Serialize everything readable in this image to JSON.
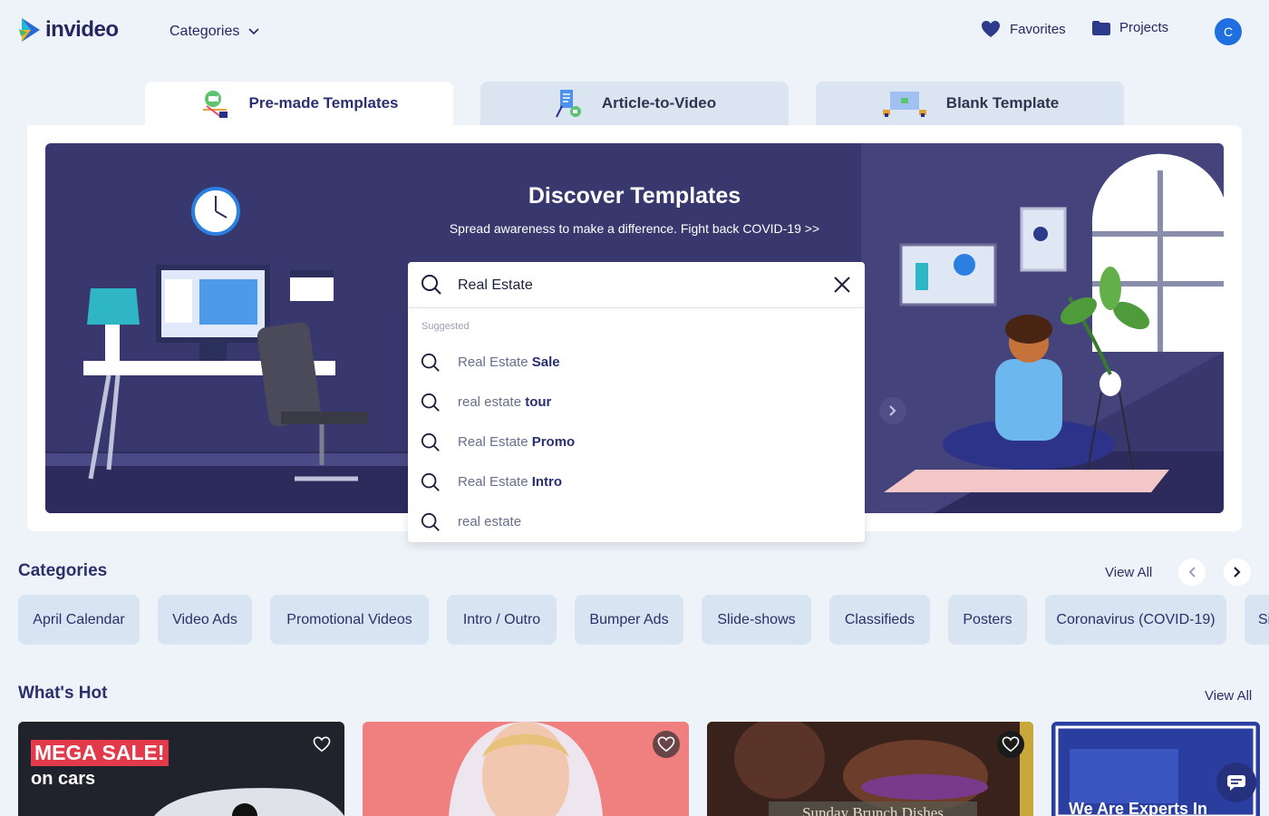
{
  "header": {
    "logo_text": "invideo",
    "categories_label": "Categories",
    "favorites_label": "Favorites",
    "projects_label": "Projects",
    "avatar_initial": "C"
  },
  "tabs": [
    {
      "label": "Pre-made Templates",
      "active": true
    },
    {
      "label": "Article-to-Video",
      "active": false
    },
    {
      "label": "Blank Template",
      "active": false
    }
  ],
  "banner": {
    "title": "Discover Templates",
    "subtitle": "Spread awareness to make a difference. Fight back COVID-19 >>"
  },
  "search": {
    "value": "Real Estate",
    "suggested_label": "Suggested",
    "suggestions": [
      {
        "prefix": "Real Estate ",
        "bold": "Sale"
      },
      {
        "prefix": "real estate ",
        "bold": "tour"
      },
      {
        "prefix": "Real Estate ",
        "bold": "Promo"
      },
      {
        "prefix": "Real Estate ",
        "bold": "Intro"
      },
      {
        "prefix": "real estate",
        "bold": ""
      }
    ]
  },
  "categories": {
    "title": "Categories",
    "view_all": "View All",
    "chips": [
      "April Calendar",
      "Video Ads",
      "Promotional Videos",
      "Intro / Outro",
      "Bumper Ads",
      "Slide-shows",
      "Classifieds",
      "Posters",
      "Coronavirus (COVID-19)",
      "Si"
    ]
  },
  "whats_hot": {
    "title": "What's Hot",
    "view_all": "View All",
    "cards": [
      {
        "line1": "MEGA SALE!",
        "line2": "on cars"
      },
      {
        "line1": "",
        "line2": ""
      },
      {
        "line1": "Sunday Brunch Dishes",
        "line2": ""
      },
      {
        "line1": "We Are Experts In",
        "line2": ""
      }
    ]
  },
  "colors": {
    "banner_bg": "#39386e",
    "accent": "#2b3068",
    "avatar": "#1f6fe0"
  }
}
